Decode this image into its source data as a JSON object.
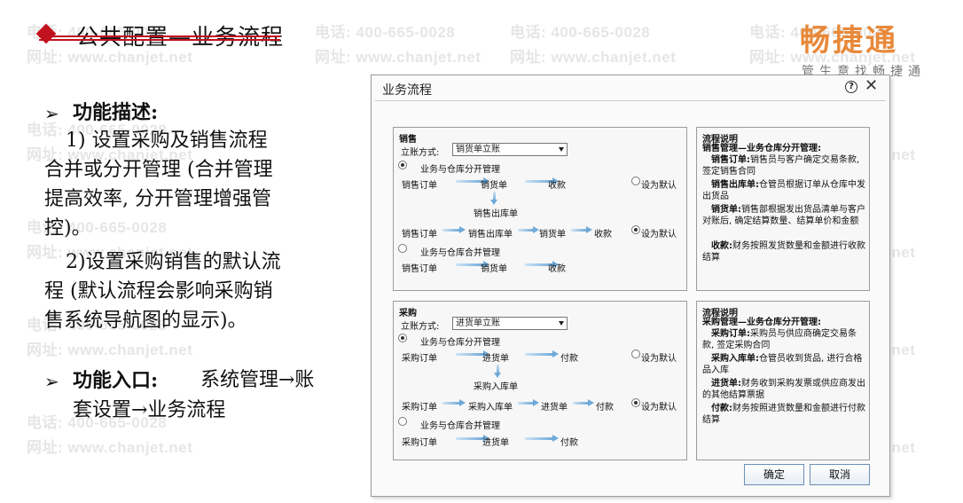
{
  "header": {
    "title": "公共配置—业务流程"
  },
  "logo": {
    "brand": "畅捷通",
    "slogan": "管生意找畅捷通"
  },
  "watermark": {
    "phone": "电话: 400-665-0028",
    "site": "网址: www.chanjet.net"
  },
  "content": {
    "func_desc_label": "功能描述:",
    "desc_lines": [
      "1) 设置采购及销售流程",
      "合并或分开管理 (合并管理",
      "提高效率, 分开管理增强管",
      "控)。",
      "2)设置采购销售的默认流",
      "程 (默认流程会影响采购销",
      "售系统导航图的显示)。"
    ],
    "entry_label": "功能入口:",
    "entry_line1": "系统管理→账",
    "entry_line2": "套设置→业务流程"
  },
  "dialog": {
    "title": "业务流程",
    "help_icon": "?",
    "close_icon": "✕",
    "sales": {
      "title": "销售",
      "mode_label": "立账方式:",
      "mode_value": "销货单立账",
      "option1": "业务与仓库分开管理",
      "option2": "业务与仓库合并管理",
      "flow1": [
        "销售订单",
        "销货单",
        "收款"
      ],
      "flow1_sub": "销售出库单",
      "flow2": [
        "销售订单",
        "销售出库单",
        "销货单",
        "收款"
      ],
      "flow3": [
        "销售订单",
        "销货单",
        "收款"
      ],
      "set_default": "设为默认"
    },
    "sales_desc": {
      "title": "流程说明",
      "heading": "销售管理—业务仓库分开管理:",
      "items": [
        {
          "term": "销售订单:",
          "text": "销售员与客户确定交易条款, 签定销售合同"
        },
        {
          "term": "销售出库单:",
          "text": "仓管员根据订单从仓库中发出货品"
        },
        {
          "term": "销货单:",
          "text": "销售部根据发出货品清单与客户对账后, 确定结算数量、结算单价和金额"
        },
        {
          "term": "收款:",
          "text": "财务按照发货数量和金额进行收款结算"
        }
      ]
    },
    "purchase": {
      "title": "采购",
      "mode_label": "立账方式:",
      "mode_value": "进货单立账",
      "option1": "业务与仓库分开管理",
      "option2": "业务与仓库合并管理",
      "flow1": [
        "采购订单",
        "进货单",
        "付款"
      ],
      "flow1_sub": "采购入库单",
      "flow2": [
        "采购订单",
        "采购入库单",
        "进货单",
        "付款"
      ],
      "flow3": [
        "采购订单",
        "进货单",
        "付款"
      ],
      "set_default": "设为默认"
    },
    "purchase_desc": {
      "title": "流程说明",
      "heading": "采购管理—业务仓库分开管理:",
      "items": [
        {
          "term": "采购订单:",
          "text": "采购员与供应商确定交易条款, 签定采购合同"
        },
        {
          "term": "采购入库单:",
          "text": "仓管员收到货品, 进行合格品入库"
        },
        {
          "term": "进货单:",
          "text": "财务收到采购发票或供应商发出的其他结算票据"
        },
        {
          "term": "付款:",
          "text": "财务按照进货数量和金额进行付款结算"
        }
      ]
    },
    "ok_label": "确定",
    "cancel_label": "取消"
  }
}
